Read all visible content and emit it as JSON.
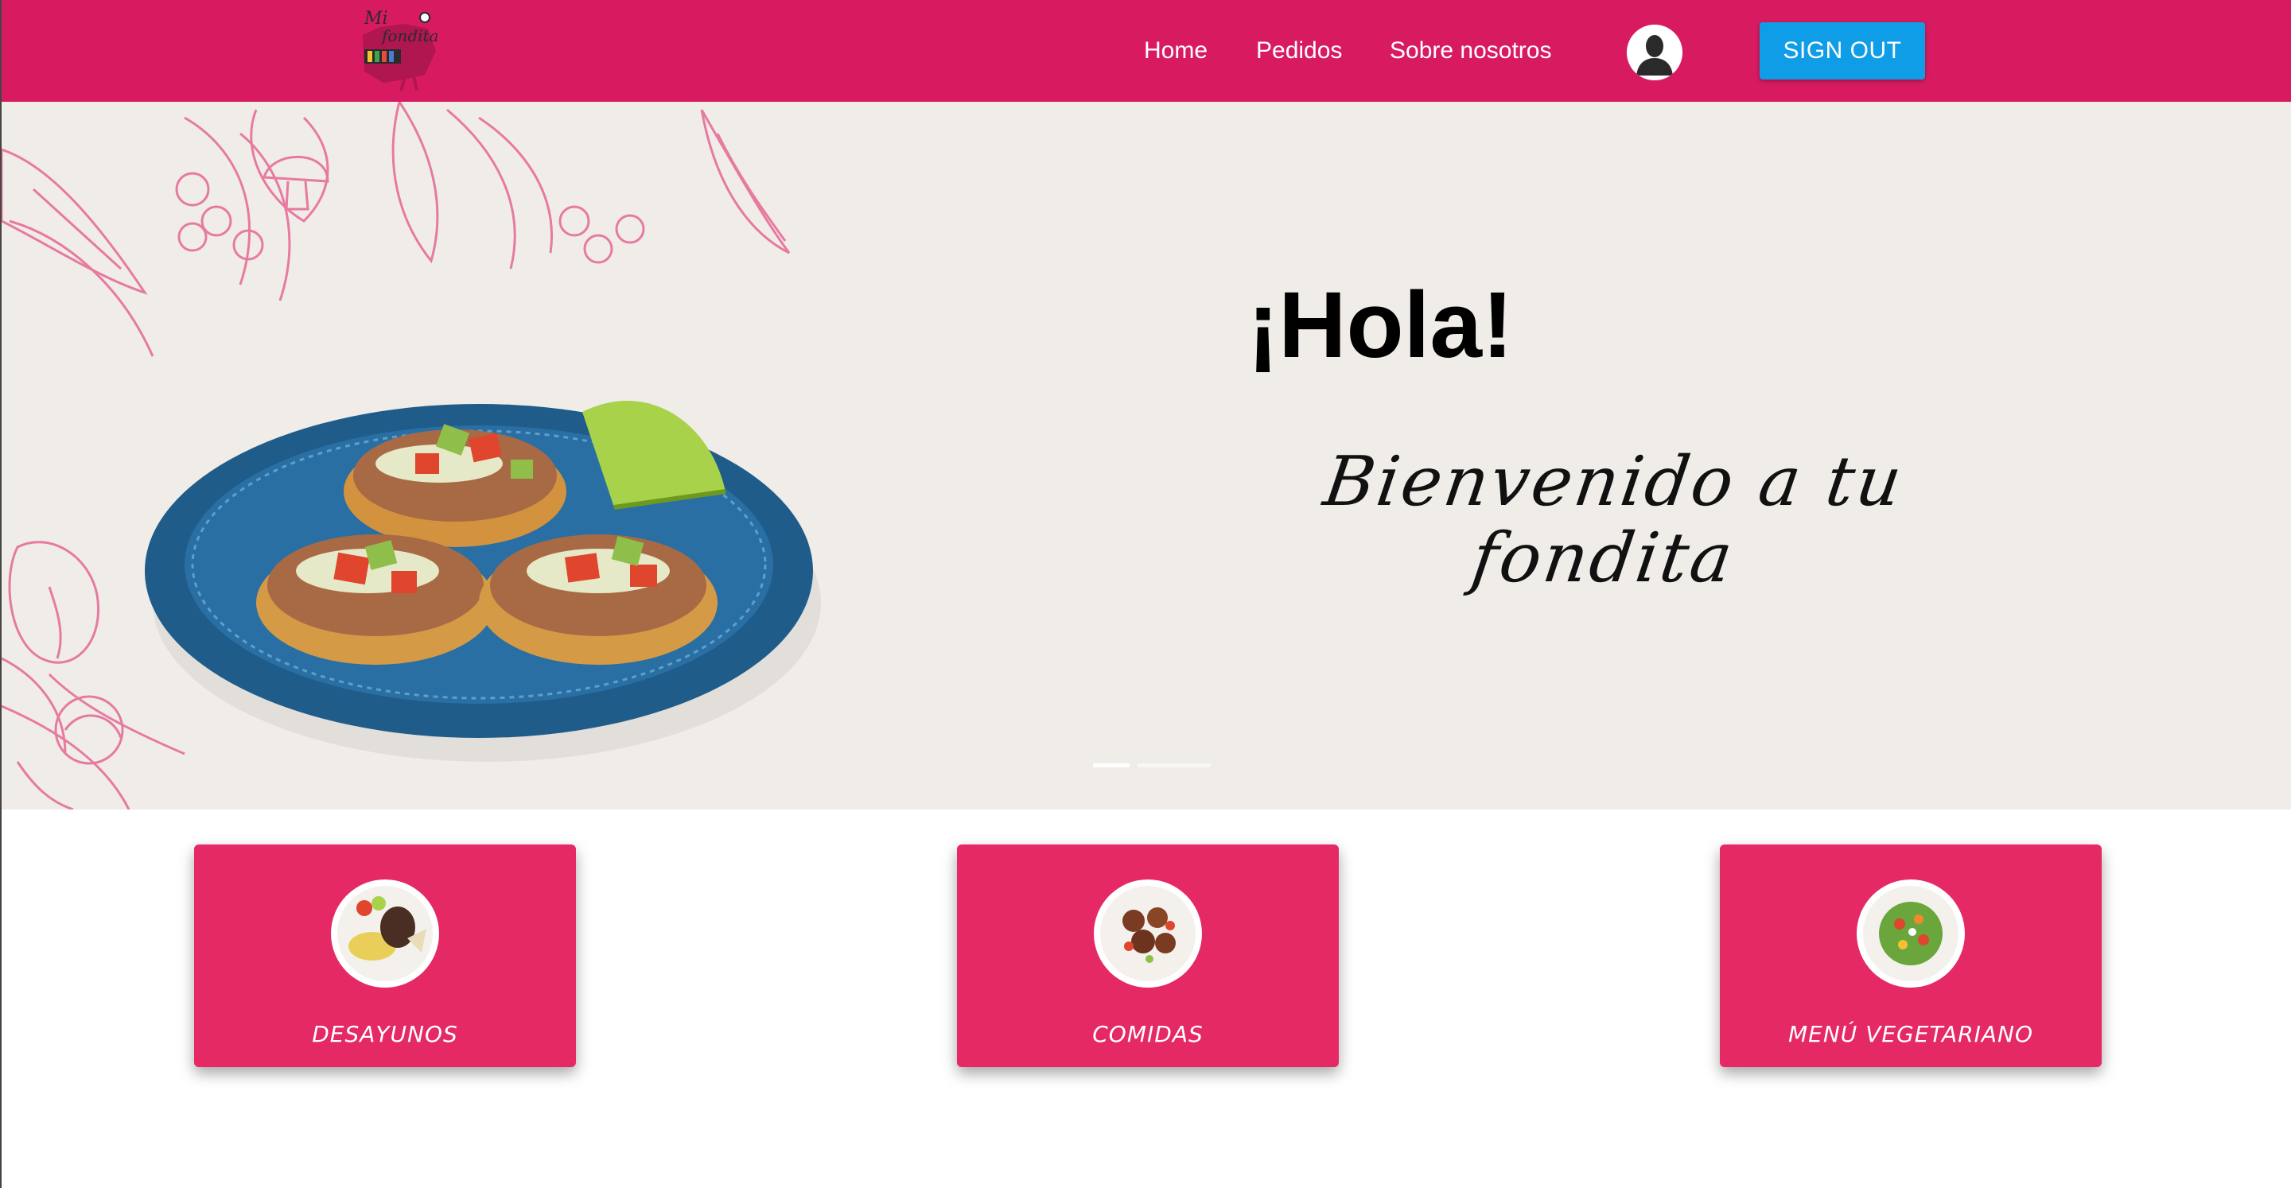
{
  "navbar": {
    "logo_text": "Mi Fondita",
    "links": [
      {
        "label": "Home"
      },
      {
        "label": "Pedidos"
      },
      {
        "label": "Sobre nosotros"
      }
    ],
    "signout_label": "SIGN OUT",
    "avatar_icon": "user-silhouette-icon"
  },
  "hero": {
    "title": "¡Hola!",
    "subtitle": "Bienvenido a tu fondita",
    "slides_total": 3,
    "active_slide": 1
  },
  "categories": [
    {
      "label": "DESAYUNOS",
      "image": "breakfast-plate"
    },
    {
      "label": "COMIDAS",
      "image": "meatballs-plate"
    },
    {
      "label": "MENÚ VEGETARIANO",
      "image": "salad-plate"
    }
  ],
  "colors": {
    "navbar": "#d81b60",
    "card": "#e52965",
    "signout_button": "#0f9de8",
    "hero_background": "#f0ede9"
  }
}
